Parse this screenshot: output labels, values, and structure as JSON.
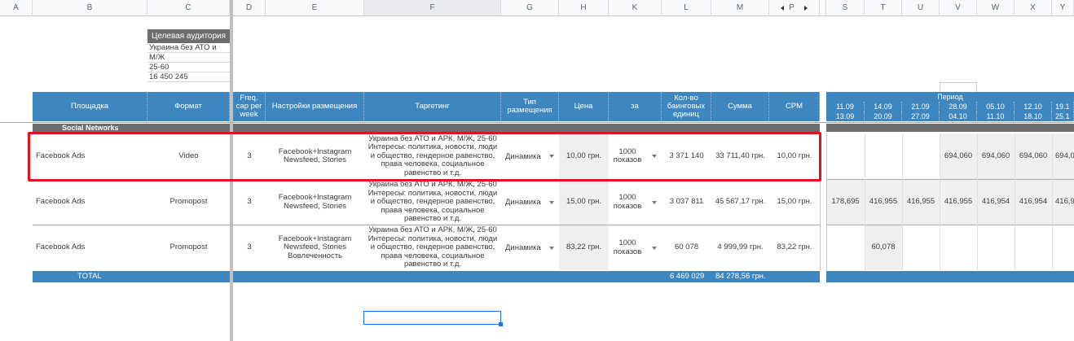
{
  "column_headers": [
    "A",
    "B",
    "C",
    "D",
    "E",
    "F",
    "G",
    "H",
    "K",
    "L",
    "M",
    "P",
    "S",
    "T",
    "U",
    "V",
    "W",
    "X",
    "Y"
  ],
  "target_audience": {
    "title": "Целевая аудитория",
    "geo": "Украина без АТО и",
    "gender": "М/Ж",
    "age": "25-60",
    "size": "16 450 245"
  },
  "header": {
    "platform": "Площадка",
    "format": "Формат",
    "freq": "Freq. cap per week",
    "settings": "Настройки размещения",
    "targeting": "Таргетинг",
    "placement_type": "Тип размещения",
    "price": "Цена",
    "per": "за",
    "banner_count": "Кол-во баинговых единиц",
    "sum": "Сумма",
    "cpm": "CPM"
  },
  "period": {
    "label": "Период",
    "weeks": [
      {
        "start": "11.09",
        "end": "13.09"
      },
      {
        "start": "14.09",
        "end": "20.09"
      },
      {
        "start": "21.09",
        "end": "27.09"
      },
      {
        "start": "28.09",
        "end": "04.10"
      },
      {
        "start": "05.10",
        "end": "11.10"
      },
      {
        "start": "12.10",
        "end": "18.10"
      },
      {
        "start": "19.1",
        "end": "25.1"
      }
    ]
  },
  "section": {
    "label": "Social Networks"
  },
  "rows": [
    {
      "platform": "Facebook Ads",
      "format": "Video",
      "freq": "3",
      "settings": "Facebook+Instagram Newsfeed, Stories",
      "targeting": "Украина без АТО и АРК, М/Ж, 25-60 Интересы: политика, новости, люди и общество, гендерное равенство, права человека, социальное равенство и т.д.",
      "placement_type": "Динамика",
      "price": "10,00 грн.",
      "per": "1000 показов",
      "banner_count": "3 371 140",
      "sum": "33 711,40 грн.",
      "cpm": "10,00 грн.",
      "weeks": [
        "",
        "",
        "",
        "694,060",
        "694,060",
        "694,060",
        "694,0"
      ]
    },
    {
      "platform": "Facebook Ads",
      "format": "Promopost",
      "freq": "3",
      "settings": "Facebook+Instagram Newsfeed, Stories",
      "targeting": "Украина без АТО и АРК, М/Ж, 25-60 Интересы: политика, новости, люди и общество, гендерное равенство, права человека, социальное равенство и т.д.",
      "placement_type": "Динамика",
      "price": "15,00 грн.",
      "per": "1000 показов",
      "banner_count": "3 037 811",
      "sum": "45 567,17 грн.",
      "cpm": "15,00 грн.",
      "weeks": [
        "178,695",
        "416,955",
        "416,955",
        "416,955",
        "416,954",
        "416,954",
        "416,9"
      ]
    },
    {
      "platform": "Facebook Ads",
      "format": "Promopost",
      "freq": "3",
      "settings": "Facebook+Instagram Newsfeed, Stories Вовлеченность",
      "targeting": "Украина без АТО и АРК, М/Ж, 25-60 Интересы: политика, новости, люди и общество, гендерное равенство, права человека, социальное равенство и т.д.",
      "placement_type": "Динамика",
      "price": "83,22 грн.",
      "per": "1000 показов",
      "banner_count": "60 078",
      "sum": "4 999,99 грн.",
      "cpm": "83,22 грн.",
      "weeks": [
        "",
        "60,078",
        "",
        "",
        "",
        "",
        ""
      ]
    }
  ],
  "total": {
    "label": "TOTAL",
    "banner_count": "6 469 029",
    "sum": "84 278,56 грн."
  },
  "colors": {
    "header_blue": "#3d86c0",
    "section_gray": "#6d6d6d",
    "highlight_red": "#e0141e",
    "selection_blue": "#1a73e8"
  }
}
